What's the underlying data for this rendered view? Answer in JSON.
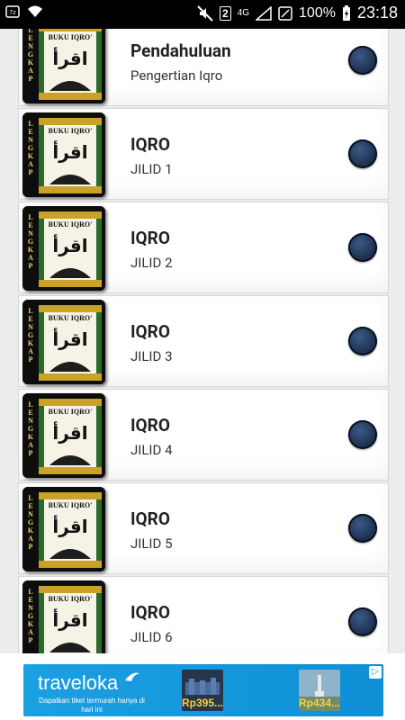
{
  "status_bar": {
    "sim_slot": "2",
    "network": "4G",
    "battery": "100%",
    "time": "23:18"
  },
  "list": [
    {
      "title": "Pendahuluan",
      "subtitle": "Pengertian Iqro"
    },
    {
      "title": "IQRO",
      "subtitle": "JILID 1"
    },
    {
      "title": "IQRO",
      "subtitle": "JILID 2"
    },
    {
      "title": "IQRO",
      "subtitle": "JILID 3"
    },
    {
      "title": "IQRO",
      "subtitle": "JILID 4"
    },
    {
      "title": "IQRO",
      "subtitle": "JILID 5"
    },
    {
      "title": "IQRO",
      "subtitle": "JILID 6"
    }
  ],
  "thumbnail": {
    "book_title": "BUKU IQRO'",
    "side_text": "LENGKAP",
    "arabic": "اقرأ"
  },
  "ad": {
    "brand": "traveloka",
    "tagline": "Dapatkan tiket termurah hanya di hari ini",
    "price_1": "Rp395...",
    "price_2": "Rp434..."
  },
  "colors": {
    "radio": "#1e3152",
    "ad_blue": "#1ba0e2",
    "list_bg": "#ececec"
  }
}
